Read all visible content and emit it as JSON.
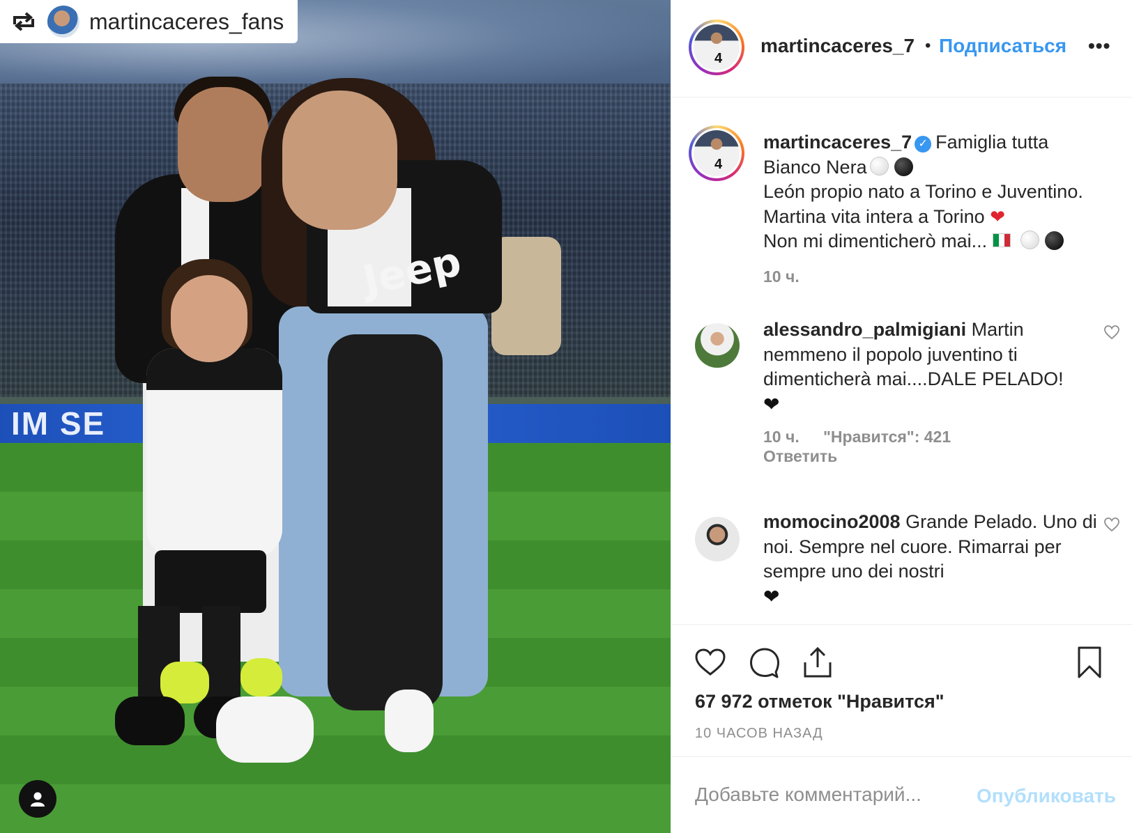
{
  "photo": {
    "repost_username": "martincaceres_fans",
    "board_text": "IM SE",
    "jersey_text": "Jeep"
  },
  "header": {
    "username": "martincaceres_7",
    "separator": "•",
    "follow_label": "Подписаться",
    "more_label": "•••"
  },
  "caption": {
    "username": "martincaceres_7",
    "line1": "Famiglia tutta",
    "line2": "Bianco Nera",
    "line3": "León propio nato a Torino e Juventino.",
    "line4": "Martina vita intera a Torino",
    "line5": "Non mi dimenticherò mai...",
    "time": "10 ч."
  },
  "comments": [
    {
      "username": "alessandro_palmigiani",
      "text": "Martin nemmeno il popolo juventino ti dimenticherà mai....DALE PELADO!",
      "time": "10 ч.",
      "likes": "\"Нравится\": 421",
      "reply": "Ответить"
    },
    {
      "username": "momocino2008",
      "text": "Grande Pelado. Uno di noi. Sempre nel cuore. Rimarrai per sempre uno dei nostri"
    }
  ],
  "actions": {
    "likes_count": "67 972 отметок \"Нравится\"",
    "timestamp": "10 ЧАСОВ НАЗАД"
  },
  "add_comment": {
    "placeholder": "Добавьте комментарий...",
    "publish_label": "Опубликовать"
  },
  "colors": {
    "accent": "#3897f0",
    "publish_disabled": "#b2dffc",
    "muted": "#8e8e8e",
    "text": "#262626"
  },
  "icons": [
    "repost-icon",
    "user-tag-icon",
    "verified-icon",
    "heart-icon",
    "comment-icon",
    "share-icon",
    "bookmark-icon",
    "more-icon"
  ]
}
